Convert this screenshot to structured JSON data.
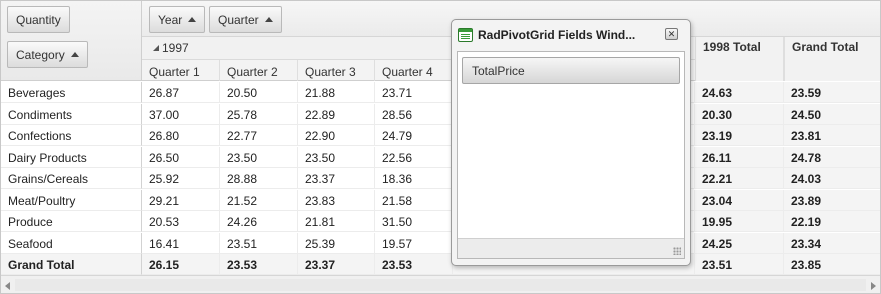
{
  "pivot": {
    "aggregate_button": "Quantity",
    "row_group_button": "Category",
    "column_group_buttons": [
      "Year",
      "Quarter"
    ],
    "year_label": "1997",
    "quarters": [
      "Quarter 1",
      "Quarter 2",
      "Quarter 3",
      "Quarter 4"
    ],
    "total_headers": [
      "1998 Total",
      "Grand Total"
    ],
    "rows": [
      {
        "label": "Beverages",
        "q": [
          "26.87",
          "20.50",
          "21.88",
          "23.71"
        ],
        "t1998": "24.63",
        "grand": "23.59"
      },
      {
        "label": "Condiments",
        "q": [
          "37.00",
          "25.78",
          "22.89",
          "28.56"
        ],
        "t1998": "20.30",
        "grand": "24.50"
      },
      {
        "label": "Confections",
        "q": [
          "26.80",
          "22.77",
          "22.90",
          "24.79"
        ],
        "t1998": "23.19",
        "grand": "23.81"
      },
      {
        "label": "Dairy Products",
        "q": [
          "26.50",
          "23.50",
          "23.50",
          "22.56"
        ],
        "t1998": "26.11",
        "grand": "24.78"
      },
      {
        "label": "Grains/Cereals",
        "q": [
          "25.92",
          "28.88",
          "23.37",
          "18.36"
        ],
        "t1998": "22.21",
        "grand": "24.03"
      },
      {
        "label": "Meat/Poultry",
        "q": [
          "29.21",
          "21.52",
          "23.83",
          "21.58"
        ],
        "t1998": "23.04",
        "grand": "23.89"
      },
      {
        "label": "Produce",
        "q": [
          "20.53",
          "24.26",
          "21.81",
          "31.50"
        ],
        "t1998": "19.95",
        "grand": "22.19"
      },
      {
        "label": "Seafood",
        "q": [
          "16.41",
          "23.51",
          "25.39",
          "19.57"
        ],
        "t1998": "24.25",
        "grand": "23.34"
      }
    ],
    "grand_total": {
      "label": "Grand Total",
      "q": [
        "26.15",
        "23.53",
        "23.37",
        "23.53"
      ],
      "t1998": "23.51",
      "grand": "23.85"
    }
  },
  "fields_window": {
    "title": "RadPivotGrid Fields Wind...",
    "close_label": "✕",
    "fields": [
      "TotalPrice"
    ]
  }
}
